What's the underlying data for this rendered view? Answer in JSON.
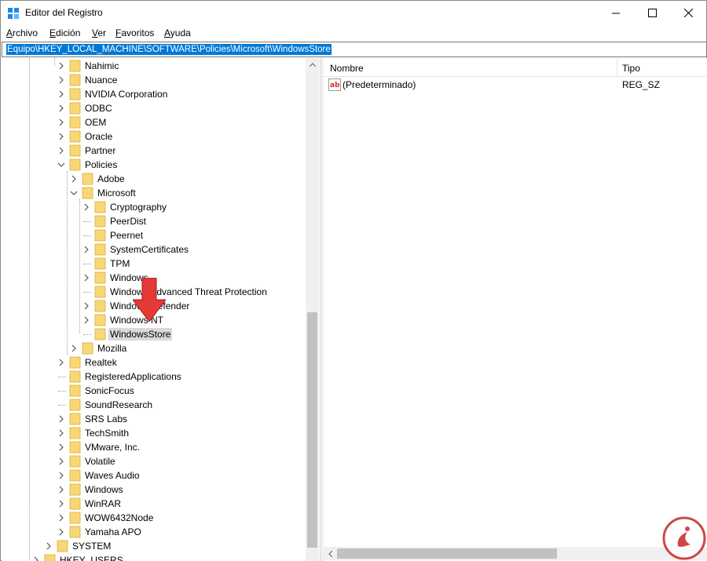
{
  "window": {
    "title": "Editor del Registro",
    "controls": {
      "minimize": "—",
      "maximize": "☐",
      "close": "✕"
    }
  },
  "menu": {
    "items": [
      {
        "label": "Archivo",
        "accel": "A",
        "rest": "rchivo"
      },
      {
        "label": "Edición",
        "accel": "E",
        "rest": "dición"
      },
      {
        "label": "Ver",
        "accel": "V",
        "rest": "er"
      },
      {
        "label": "Favoritos",
        "accel": "F",
        "rest": "avoritos"
      },
      {
        "label": "Ayuda",
        "accel": "A",
        "rest": "yuda"
      }
    ]
  },
  "address": {
    "path": "Equipo\\HKEY_LOCAL_MACHINE\\SOFTWARE\\Policies\\Microsoft\\WindowsStore"
  },
  "tree": {
    "nodes": [
      {
        "label": "Nahimic",
        "expand": "collapsed"
      },
      {
        "label": "Nuance",
        "expand": "collapsed"
      },
      {
        "label": "NVIDIA Corporation",
        "expand": "collapsed"
      },
      {
        "label": "ODBC",
        "expand": "collapsed"
      },
      {
        "label": "OEM",
        "expand": "collapsed"
      },
      {
        "label": "Oracle",
        "expand": "collapsed"
      },
      {
        "label": "Partner",
        "expand": "collapsed"
      },
      {
        "label": "Policies",
        "expand": "expanded"
      },
      {
        "label": "Adobe",
        "expand": "collapsed"
      },
      {
        "label": "Microsoft",
        "expand": "expanded"
      },
      {
        "label": "Cryptography",
        "expand": "collapsed"
      },
      {
        "label": "PeerDist",
        "expand": "none"
      },
      {
        "label": "Peernet",
        "expand": "none"
      },
      {
        "label": "SystemCertificates",
        "expand": "collapsed"
      },
      {
        "label": "TPM",
        "expand": "none"
      },
      {
        "label": "Windows",
        "expand": "collapsed"
      },
      {
        "label": "Windows Advanced Threat Protection",
        "expand": "none"
      },
      {
        "label": "Windows Defender",
        "expand": "collapsed"
      },
      {
        "label": "Windows NT",
        "expand": "collapsed"
      },
      {
        "label": "WindowsStore",
        "expand": "none",
        "selected": true
      },
      {
        "label": "Mozilla",
        "expand": "collapsed"
      },
      {
        "label": "Realtek",
        "expand": "collapsed"
      },
      {
        "label": "RegisteredApplications",
        "expand": "none"
      },
      {
        "label": "SonicFocus",
        "expand": "none"
      },
      {
        "label": "SoundResearch",
        "expand": "none"
      },
      {
        "label": "SRS Labs",
        "expand": "collapsed"
      },
      {
        "label": "TechSmith",
        "expand": "collapsed"
      },
      {
        "label": "VMware, Inc.",
        "expand": "collapsed"
      },
      {
        "label": "Volatile",
        "expand": "collapsed"
      },
      {
        "label": "Waves Audio",
        "expand": "collapsed"
      },
      {
        "label": "Windows",
        "expand": "collapsed"
      },
      {
        "label": "WinRAR",
        "expand": "collapsed"
      },
      {
        "label": "WOW6432Node",
        "expand": "collapsed"
      },
      {
        "label": "Yamaha APO",
        "expand": "collapsed"
      },
      {
        "label": "SYSTEM",
        "expand": "collapsed"
      },
      {
        "label": "HKEY_USERS",
        "expand": "collapsed"
      }
    ]
  },
  "list": {
    "columns": [
      "Nombre",
      "Tipo"
    ],
    "rows": [
      {
        "name": "(Predeterminado)",
        "type": "REG_SZ",
        "icon": "string-value-icon"
      }
    ]
  },
  "colors": {
    "selection": "#0078d7",
    "folder": "#f8d775",
    "folder_edge": "#d9ae3f",
    "annotation_arrow": "#e53935"
  }
}
